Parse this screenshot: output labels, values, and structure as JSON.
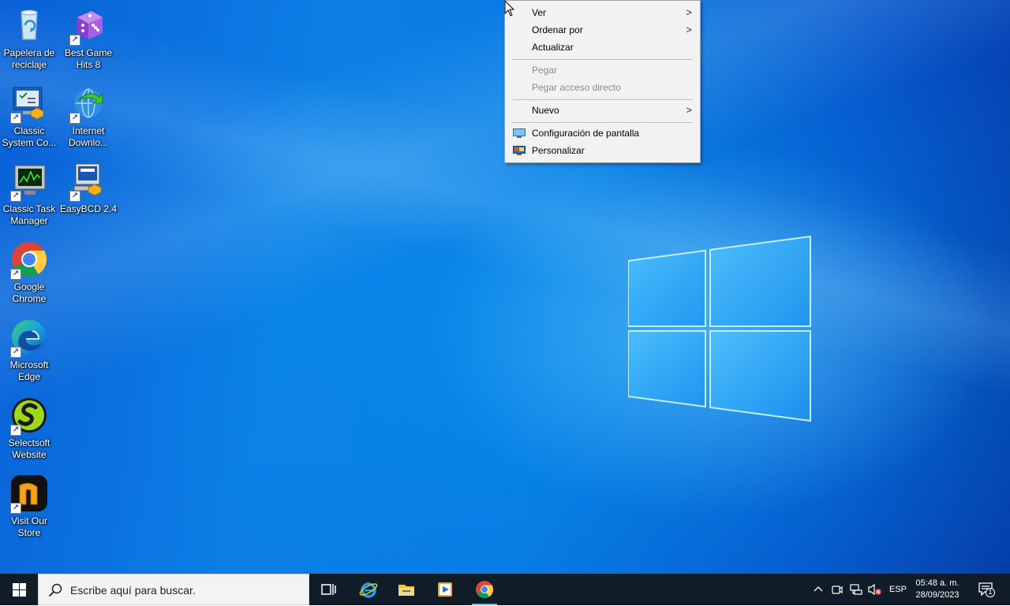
{
  "desktop": {
    "icons": [
      {
        "label": "Papelera de reciclaje",
        "icon": "recycle-bin-icon"
      },
      {
        "label": "Best Game Hits 8",
        "icon": "dice-icon"
      },
      {
        "label": "Classic System Co...",
        "icon": "system-config-icon"
      },
      {
        "label": "Internet Downlo...",
        "icon": "internet-download-icon"
      },
      {
        "label": "Classic Task Manager",
        "icon": "task-manager-icon"
      },
      {
        "label": "EasyBCD 2.4",
        "icon": "easybcd-icon"
      },
      {
        "label": "Google Chrome",
        "icon": "chrome-icon"
      },
      {
        "label": "Microsoft Edge",
        "icon": "edge-icon"
      },
      {
        "label": "Selectsoft Website",
        "icon": "selectsoft-icon"
      },
      {
        "label": "Visit Our Store",
        "icon": "store-icon"
      }
    ]
  },
  "context_menu": {
    "items": [
      {
        "label": "Ver",
        "submenu": true,
        "enabled": true
      },
      {
        "label": "Ordenar por",
        "submenu": true,
        "enabled": true
      },
      {
        "label": "Actualizar",
        "enabled": true
      },
      {
        "label": "Pegar",
        "enabled": false
      },
      {
        "label": "Pegar acceso directo",
        "enabled": false
      },
      {
        "label": "Nuevo",
        "submenu": true,
        "enabled": true
      },
      {
        "label": "Configuración de pantalla",
        "icon": "display-settings-icon",
        "enabled": true
      },
      {
        "label": "Personalizar",
        "icon": "personalize-icon",
        "enabled": true
      }
    ],
    "submenu_arrow": ">"
  },
  "taskbar": {
    "search_placeholder": "Escribe aquí para buscar.",
    "pinned": [
      {
        "icon": "task-view-icon"
      },
      {
        "icon": "internet-explorer-icon"
      },
      {
        "icon": "file-explorer-icon"
      },
      {
        "icon": "media-player-icon"
      },
      {
        "icon": "chrome-icon"
      }
    ],
    "tray": {
      "language": "ESP",
      "time": "05:48 a. m.",
      "date": "28/09/2023",
      "notification_count": "1"
    }
  },
  "colors": {
    "taskbar": "#101c28",
    "menu_bg": "#f2f2f2",
    "accent": "#0a78e2"
  }
}
